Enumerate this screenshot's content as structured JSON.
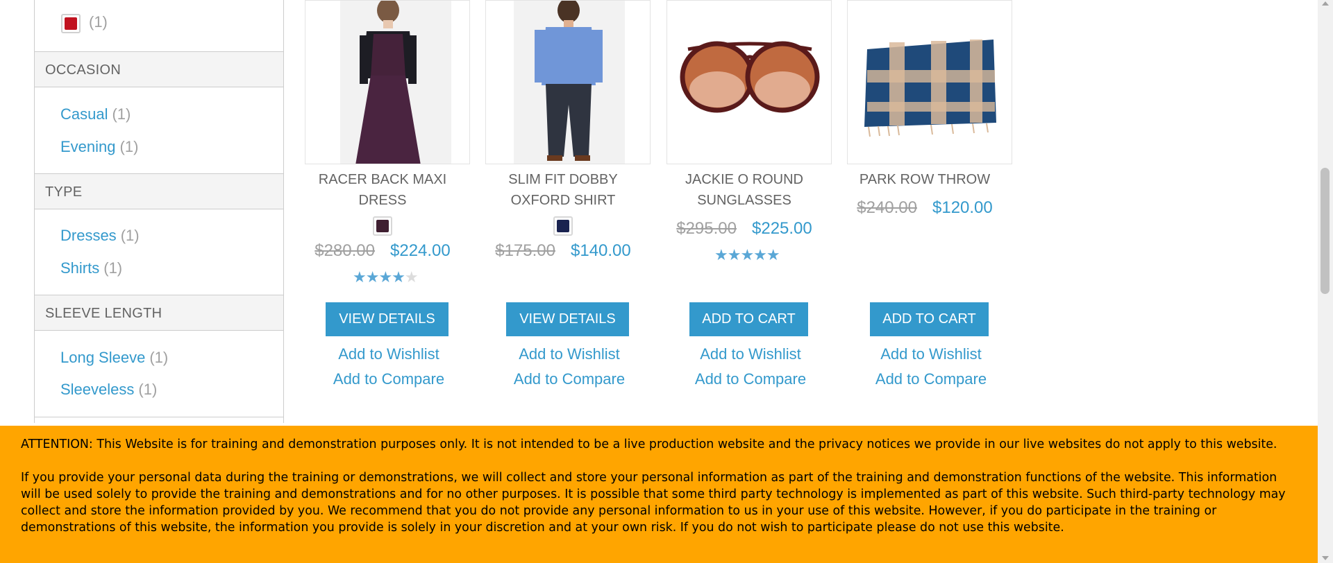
{
  "sidebar": {
    "color_filter": {
      "count": "(1)"
    },
    "sections": [
      {
        "title": "OCCASION",
        "items": [
          {
            "label": "Casual",
            "count": "(1)"
          },
          {
            "label": "Evening",
            "count": "(1)"
          }
        ]
      },
      {
        "title": "TYPE",
        "items": [
          {
            "label": "Dresses",
            "count": "(1)"
          },
          {
            "label": "Shirts",
            "count": "(1)"
          }
        ]
      },
      {
        "title": "SLEEVE LENGTH",
        "items": [
          {
            "label": "Long Sleeve",
            "count": "(1)"
          },
          {
            "label": "Sleeveless",
            "count": "(1)"
          }
        ]
      }
    ]
  },
  "products": [
    {
      "name_line1": "RACER BACK MAXI",
      "name_line2": "DRESS",
      "swatch_color": "#3f1f31",
      "old_price": "$280.00",
      "new_price": "$224.00",
      "rating": 4,
      "button": "VIEW DETAILS",
      "wishlist": "Add to Wishlist",
      "compare": "Add to Compare"
    },
    {
      "name_line1": "SLIM FIT DOBBY",
      "name_line2": "OXFORD SHIRT",
      "swatch_color": "#1a2350",
      "old_price": "$175.00",
      "new_price": "$140.00",
      "button": "VIEW DETAILS",
      "wishlist": "Add to Wishlist",
      "compare": "Add to Compare"
    },
    {
      "name_line1": "JACKIE O ROUND",
      "name_line2": "SUNGLASSES",
      "old_price": "$295.00",
      "new_price": "$225.00",
      "rating": 5,
      "button": "ADD TO CART",
      "wishlist": "Add to Wishlist",
      "compare": "Add to Compare"
    },
    {
      "name_line1": "PARK ROW THROW",
      "old_price": "$240.00",
      "new_price": "$120.00",
      "button": "ADD TO CART",
      "wishlist": "Add to Wishlist",
      "compare": "Add to Compare"
    }
  ],
  "banner": {
    "paragraph1": "ATTENTION: This Website is for training and demonstration purposes only. It is not intended to be a live production website and the privacy notices we provide in our live websites do not apply to this website.",
    "paragraph2": "If you provide your personal data during the training or demonstrations, we will collect and store your personal information as part of the training and demonstration functions of the website. This information will be used solely to provide the training and demonstrations and for no other purposes. It is possible that some third party technology is implemented as part of this website. Such third-party technology may collect and store the information provided by you. We recommend that you do not provide any personal information to us in your use of this website. However, if you do participate in the training or demonstrations of this website, the information you provide is solely in your discretion and at your own risk. If you do not wish to participate please do not use this website."
  },
  "colors": {
    "accent": "#3399cc",
    "banner": "#ffa500",
    "red_swatch": "#c1121f"
  }
}
